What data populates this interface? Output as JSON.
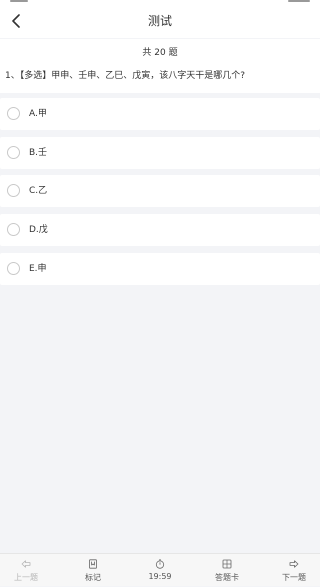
{
  "nav": {
    "title": "测试"
  },
  "question": {
    "count_text": "共 20 题",
    "text": "1、【多选】甲申、壬申、乙巳、戊寅，该八字天干是哪几个?"
  },
  "options": [
    {
      "label": "A.甲"
    },
    {
      "label": "B.壬"
    },
    {
      "label": "C.乙"
    },
    {
      "label": "D.戊"
    },
    {
      "label": "E.申"
    }
  ],
  "bottom_bar": {
    "prev_label": "上一题",
    "mark_label": "标记",
    "timer": "19:59",
    "answer_card_label": "答题卡",
    "next_label": "下一题"
  },
  "colors": {
    "background": "#f3f4f7",
    "card": "#ffffff",
    "text": "#333333",
    "disabled": "#b5b5b5"
  },
  "icons": {
    "back": "chevron-left-icon",
    "prev": "arrow-left-icon",
    "mark": "bookmark-icon",
    "timer": "stopwatch-icon",
    "answer_card": "grid-card-icon",
    "next": "arrow-right-icon"
  }
}
